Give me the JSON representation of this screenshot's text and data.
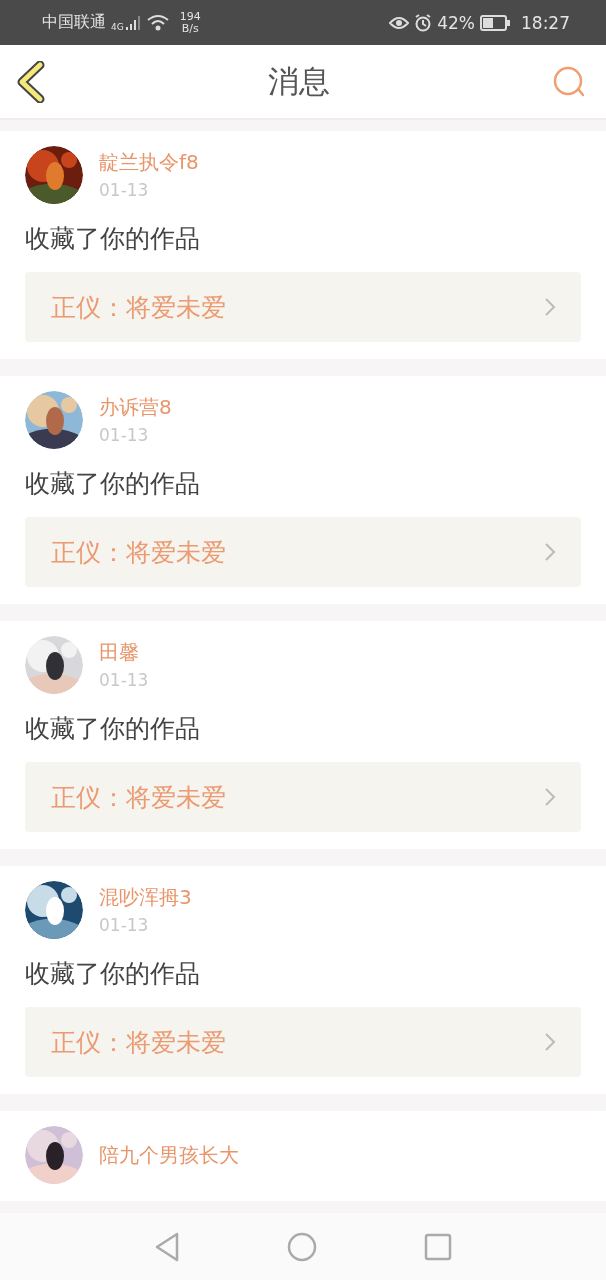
{
  "status_bar": {
    "carrier": "中国联通",
    "network": "4G",
    "speed": "194",
    "speed_unit": "B/s",
    "battery": "42%",
    "time": "18:27"
  },
  "header": {
    "title": "消息"
  },
  "messages": [
    {
      "user": "靛兰执令f8",
      "date": "01-13",
      "action": "收藏了你的作品",
      "work": "正仪：将爱未爱"
    },
    {
      "user": "办诉营8",
      "date": "01-13",
      "action": "收藏了你的作品",
      "work": "正仪：将爱未爱"
    },
    {
      "user": "田馨",
      "date": "01-13",
      "action": "收藏了你的作品",
      "work": "正仪：将爱未爱"
    },
    {
      "user": "混吵浑拇3",
      "date": "01-13",
      "action": "收藏了你的作品",
      "work": "正仪：将爱未爱"
    },
    {
      "user": "陪九个男孩长大"
    }
  ]
}
